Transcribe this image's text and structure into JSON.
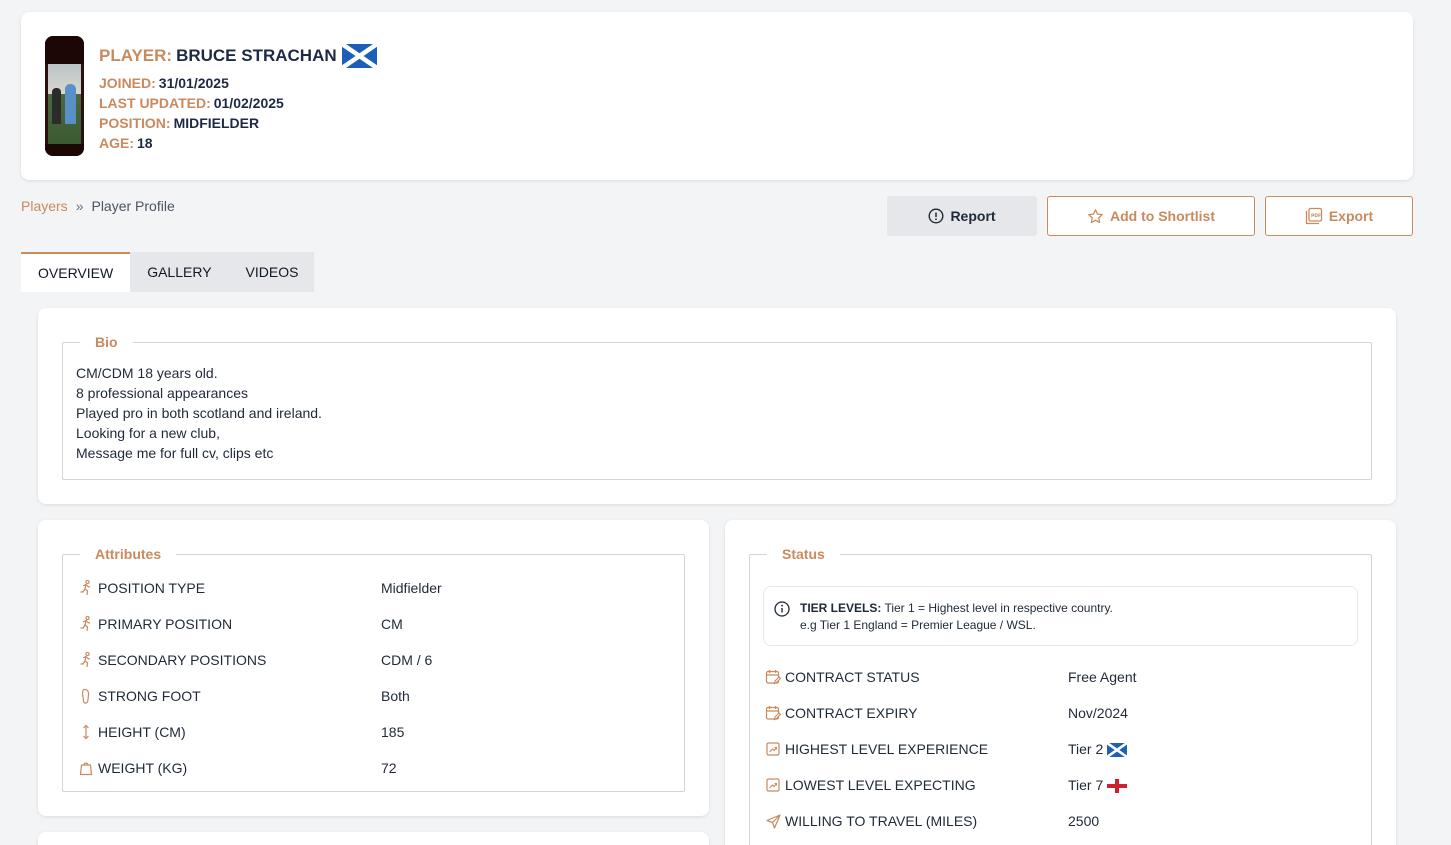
{
  "player": {
    "name_label": "PLAYER:",
    "name": "BRUCE STRACHAN",
    "flag_icon": "scotland-flag-icon",
    "joined_label": "JOINED:",
    "joined": "31/01/2025",
    "updated_label": "LAST UPDATED:",
    "updated": "01/02/2025",
    "position_label": "POSITION:",
    "position": "MIDFIELDER",
    "age_label": "AGE:",
    "age": "18"
  },
  "breadcrumb": {
    "link": "Players",
    "separator": "»",
    "current": "Player Profile"
  },
  "actions": {
    "report": "Report",
    "shortlist": "Add to Shortlist",
    "export": "Export"
  },
  "tabs": [
    {
      "label": "OVERVIEW",
      "active": true
    },
    {
      "label": "GALLERY",
      "active": false
    },
    {
      "label": "VIDEOS",
      "active": false
    }
  ],
  "bio": {
    "title": "Bio",
    "text": "CM/CDM  18 years old.\n8 professional appearances\nPlayed pro in both scotland and ireland.\nLooking for a new club,\nMessage me for full cv, clips etc"
  },
  "attributes": {
    "title": "Attributes",
    "rows": [
      {
        "icon": "running-icon",
        "label": "POSITION TYPE",
        "value": "Midfielder"
      },
      {
        "icon": "running-icon",
        "label": "PRIMARY POSITION",
        "value": "CM"
      },
      {
        "icon": "running-icon",
        "label": "SECONDARY POSITIONS",
        "value": "CDM / 6"
      },
      {
        "icon": "foot-icon",
        "label": "STRONG FOOT",
        "value": "Both"
      },
      {
        "icon": "height-arrows-icon",
        "label": "HEIGHT (CM)",
        "value": "185"
      },
      {
        "icon": "weight-icon",
        "label": "WEIGHT (KG)",
        "value": "72"
      }
    ]
  },
  "status": {
    "title": "Status",
    "info_bold": "TIER LEVELS:",
    "info_line1": " Tier 1 = Highest level in respective country.",
    "info_line2": "e.g Tier 1 England = Premier League / WSL.",
    "rows": [
      {
        "icon": "calendar-edit-icon",
        "label": "CONTRACT STATUS",
        "value": "Free Agent",
        "flag": ""
      },
      {
        "icon": "calendar-edit-icon",
        "label": "CONTRACT EXPIRY",
        "value": "Nov/2024",
        "flag": ""
      },
      {
        "icon": "trend-up-icon",
        "label": "HIGHEST LEVEL EXPERIENCE",
        "value": "Tier 2",
        "flag": "scotland-flag-icon"
      },
      {
        "icon": "trend-up-icon",
        "label": "LOWEST LEVEL EXPECTING",
        "value": "Tier 7",
        "flag": "england-flag-icon"
      },
      {
        "icon": "send-icon",
        "label": "WILLING TO TRAVEL (MILES)",
        "value": "2500",
        "flag": ""
      }
    ]
  },
  "colors": {
    "accent": "#c98a5e",
    "background": "#f3f4f6",
    "text_dark": "#1e2a44"
  }
}
